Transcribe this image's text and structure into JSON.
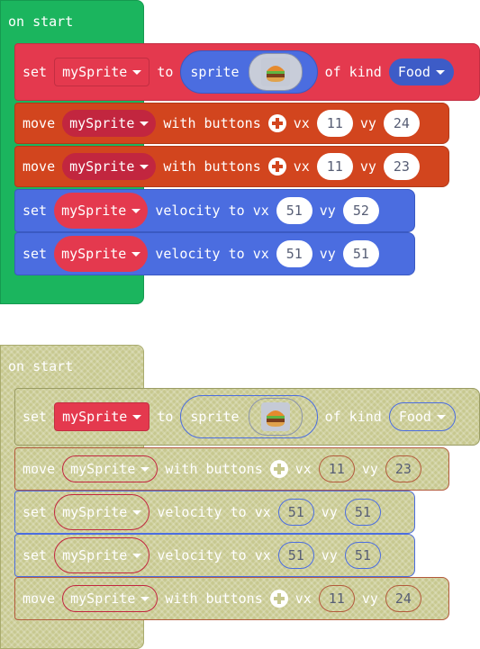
{
  "colors": {
    "hat_green": "#1BB55E",
    "sprite_red": "#E4394E",
    "controller_orange": "#D2451E",
    "physics_blue": "#4B6DE0",
    "faded_olive": "#C7C88F"
  },
  "top_stack": {
    "hat_label": "on start",
    "set_sprite": {
      "set_label": "set",
      "var": "mySprite",
      "to_label": "to",
      "sprite_label": "sprite",
      "sprite_icon": "burger-icon",
      "of_kind_label": "of kind",
      "kind": "Food"
    },
    "move_1": {
      "move_label": "move",
      "var": "mySprite",
      "with_label": "with buttons",
      "vx_label": "vx",
      "vx": "11",
      "vy_label": "vy",
      "vy": "24"
    },
    "move_2": {
      "move_label": "move",
      "var": "mySprite",
      "with_label": "with buttons",
      "vx_label": "vx",
      "vx": "11",
      "vy_label": "vy",
      "vy": "23"
    },
    "vel_1": {
      "set_label": "set",
      "var": "mySprite",
      "vel_label": "velocity to vx",
      "vx": "51",
      "vy_label": "vy",
      "vy": "52"
    },
    "vel_2": {
      "set_label": "set",
      "var": "mySprite",
      "vel_label": "velocity to vx",
      "vx": "51",
      "vy_label": "vy",
      "vy": "51"
    }
  },
  "bottom_stack": {
    "hat_label": "on start",
    "set_sprite": {
      "set_label": "set",
      "var": "mySprite",
      "to_label": "to",
      "sprite_label": "sprite",
      "sprite_icon": "burger-icon",
      "of_kind_label": "of kind",
      "kind": "Food"
    },
    "move_1": {
      "move_label": "move",
      "var": "mySprite",
      "with_label": "with buttons",
      "vx_label": "vx",
      "vx": "11",
      "vy_label": "vy",
      "vy": "23"
    },
    "vel_1": {
      "set_label": "set",
      "var": "mySprite",
      "vel_label": "velocity to vx",
      "vx": "51",
      "vy_label": "vy",
      "vy": "51"
    },
    "vel_2": {
      "set_label": "set",
      "var": "mySprite",
      "vel_label": "velocity to vx",
      "vx": "51",
      "vy_label": "vy",
      "vy": "51"
    },
    "move_2": {
      "move_label": "move",
      "var": "mySprite",
      "with_label": "with buttons",
      "vx_label": "vx",
      "vx": "11",
      "vy_label": "vy",
      "vy": "24"
    }
  }
}
